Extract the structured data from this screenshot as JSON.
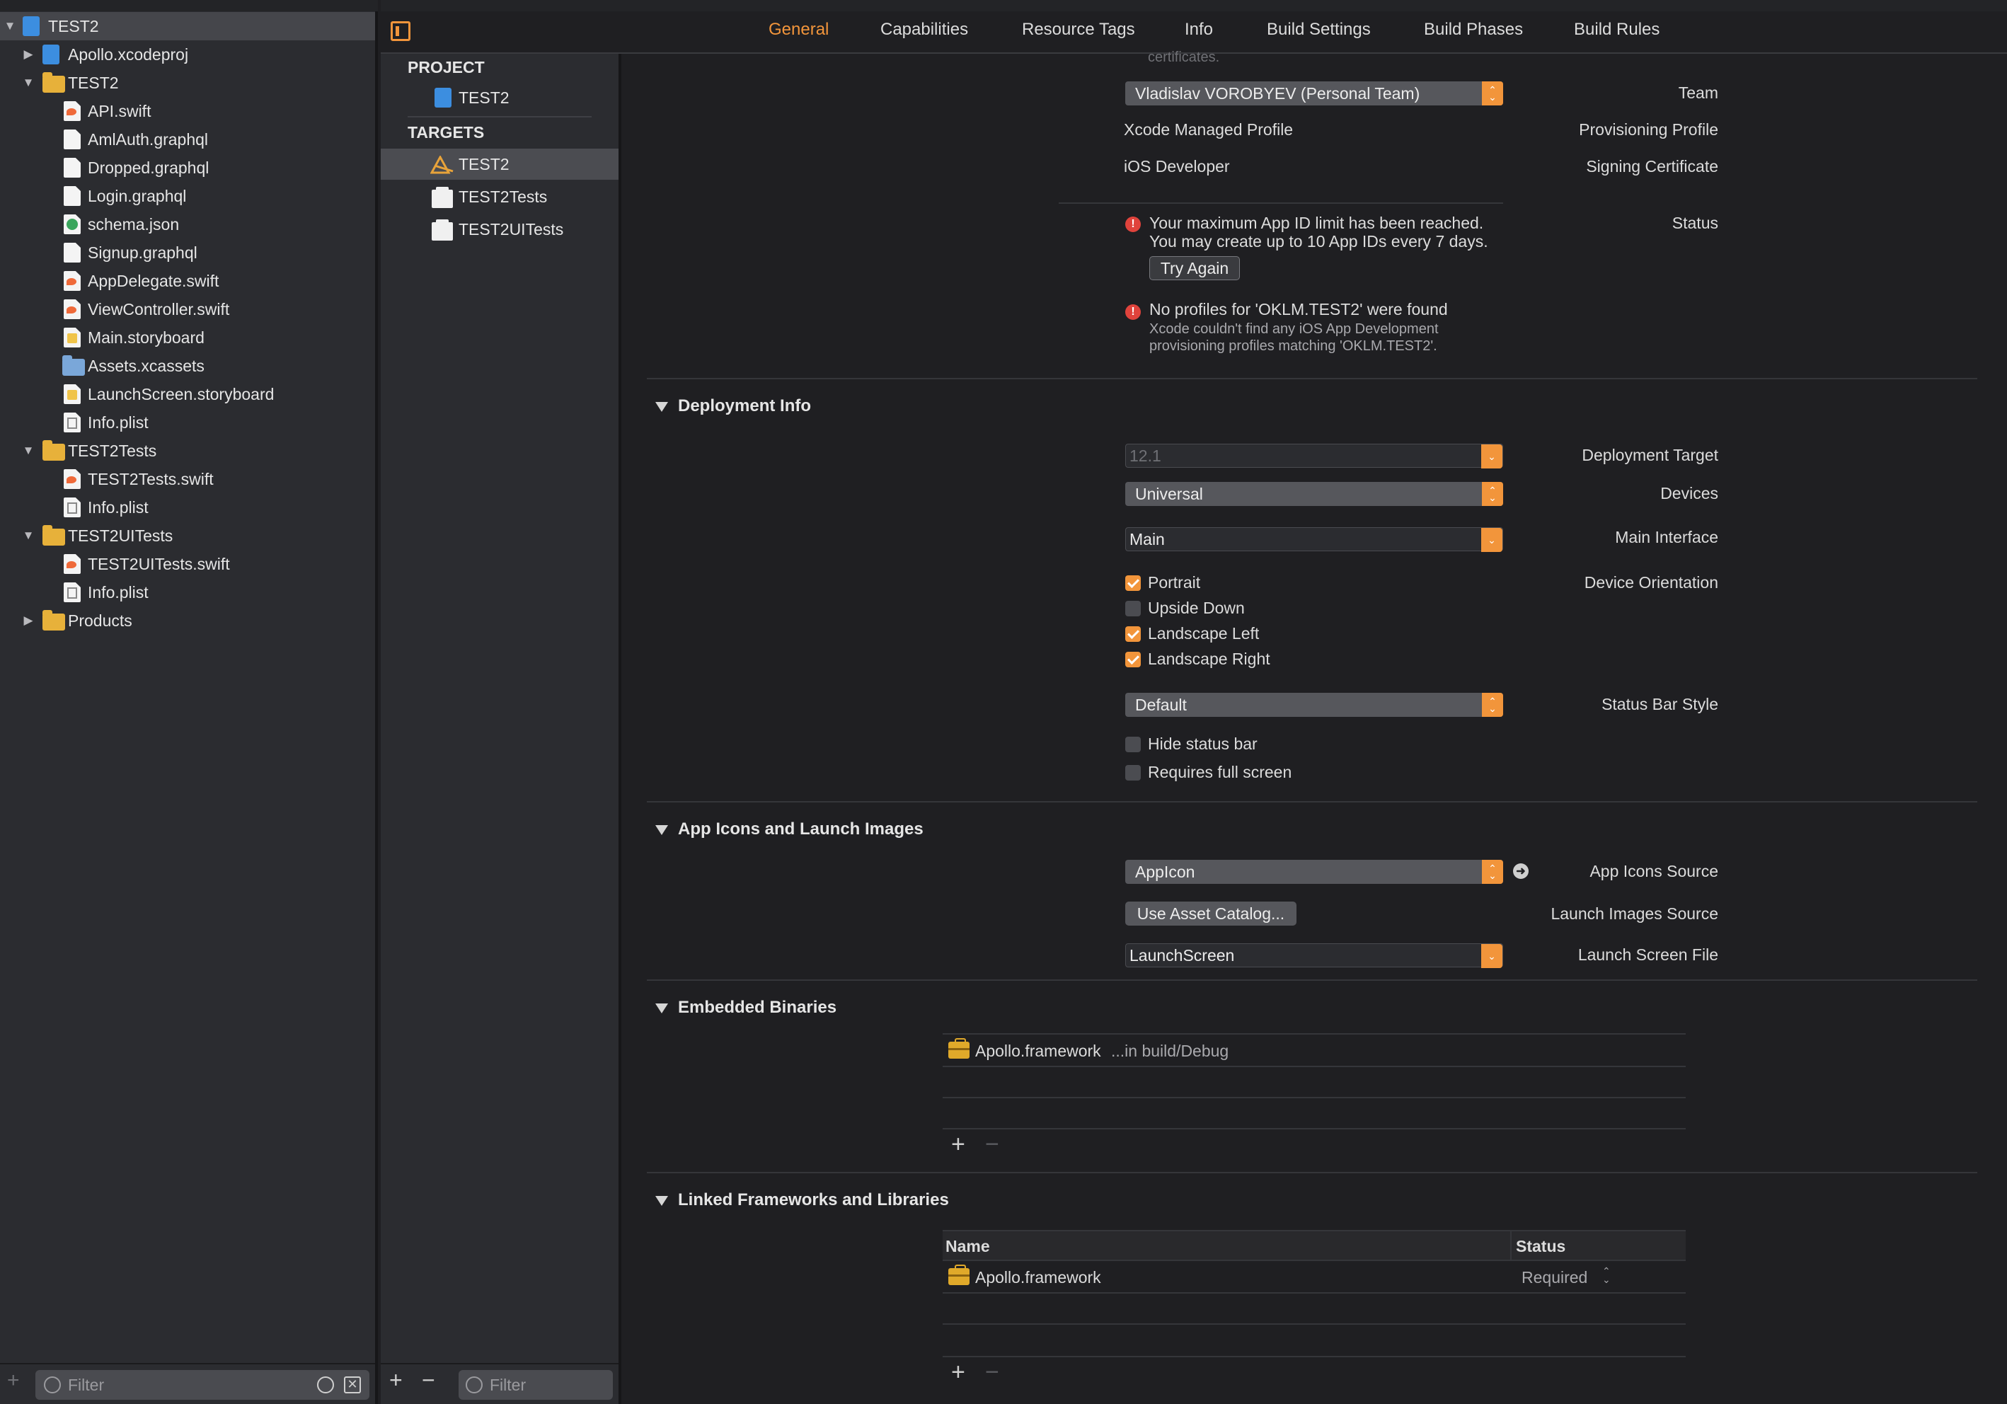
{
  "navigator": {
    "items": [
      {
        "label": "TEST2",
        "icon": "project-icon"
      },
      {
        "label": "Apollo.xcodeproj",
        "icon": "project-icon"
      },
      {
        "label": "TEST2",
        "icon": "folder-icon"
      },
      {
        "label": "API.swift",
        "icon": "swift-file-icon"
      },
      {
        "label": "AmlAuth.graphql",
        "icon": "file-icon"
      },
      {
        "label": "Dropped.graphql",
        "icon": "file-icon"
      },
      {
        "label": "Login.graphql",
        "icon": "file-icon"
      },
      {
        "label": "schema.json",
        "icon": "json-file-icon"
      },
      {
        "label": "Signup.graphql",
        "icon": "file-icon"
      },
      {
        "label": "AppDelegate.swift",
        "icon": "swift-file-icon"
      },
      {
        "label": "ViewController.swift",
        "icon": "swift-file-icon"
      },
      {
        "label": "Main.storyboard",
        "icon": "storyboard-file-icon"
      },
      {
        "label": "Assets.xcassets",
        "icon": "asset-catalog-icon"
      },
      {
        "label": "LaunchScreen.storyboard",
        "icon": "storyboard-file-icon"
      },
      {
        "label": "Info.plist",
        "icon": "plist-file-icon"
      },
      {
        "label": "TEST2Tests",
        "icon": "folder-icon"
      },
      {
        "label": "TEST2Tests.swift",
        "icon": "swift-file-icon"
      },
      {
        "label": "Info.plist",
        "icon": "plist-file-icon"
      },
      {
        "label": "TEST2UITests",
        "icon": "folder-icon"
      },
      {
        "label": "TEST2UITests.swift",
        "icon": "swift-file-icon"
      },
      {
        "label": "Info.plist",
        "icon": "plist-file-icon"
      },
      {
        "label": "Products",
        "icon": "folder-icon"
      }
    ],
    "filter_placeholder": "Filter"
  },
  "middle": {
    "project_header": "PROJECT",
    "project_item": "TEST2",
    "targets_header": "TARGETS",
    "targets": [
      "TEST2",
      "TEST2Tests",
      "TEST2UITests"
    ],
    "filter_placeholder": "Filter"
  },
  "tabs": [
    "General",
    "Capabilities",
    "Resource Tags",
    "Info",
    "Build Settings",
    "Build Phases",
    "Build Rules"
  ],
  "active_tab": "General",
  "signing": {
    "cut_text": "certificates.",
    "team_label": "Team",
    "team_value": "Vladislav VOROBYEV (Personal Team)",
    "profile_label": "Provisioning Profile",
    "profile_value": "Xcode Managed Profile",
    "cert_label": "Signing Certificate",
    "cert_value": "iOS Developer",
    "status_label": "Status",
    "error1_line1": "Your maximum App ID limit has been reached.",
    "error1_line2": "You may create up to 10 App IDs every 7 days.",
    "try_again": "Try Again",
    "error2_title": "No profiles for 'OKLM.TEST2' were found",
    "error2_line1": "Xcode couldn't find any iOS App Development",
    "error2_line2": "provisioning profiles matching 'OKLM.TEST2'."
  },
  "deployment": {
    "title": "Deployment Info",
    "target_label": "Deployment Target",
    "target_value": "12.1",
    "devices_label": "Devices",
    "devices_value": "Universal",
    "main_interface_label": "Main Interface",
    "main_interface_value": "Main",
    "orientation_label": "Device Orientation",
    "orientations": [
      {
        "label": "Portrait",
        "checked": true
      },
      {
        "label": "Upside Down",
        "checked": false
      },
      {
        "label": "Landscape Left",
        "checked": true
      },
      {
        "label": "Landscape Right",
        "checked": true
      }
    ],
    "status_bar_label": "Status Bar Style",
    "status_bar_value": "Default",
    "hide_status_bar": "Hide status bar",
    "full_screen": "Requires full screen"
  },
  "app_icons": {
    "title": "App Icons and Launch Images",
    "icons_source_label": "App Icons Source",
    "icons_source_value": "AppIcon",
    "launch_images_label": "Launch Images Source",
    "launch_images_button": "Use Asset Catalog...",
    "launch_screen_label": "Launch Screen File",
    "launch_screen_value": "LaunchScreen"
  },
  "embedded": {
    "title": "Embedded Binaries",
    "item_name": "Apollo.framework",
    "item_path": "...in build/Debug"
  },
  "linked": {
    "title": "Linked Frameworks and Libraries",
    "col_name": "Name",
    "col_status": "Status",
    "item_name": "Apollo.framework",
    "item_status": "Required"
  },
  "colors": {
    "accent": "#f2953b",
    "error": "#e0433c",
    "background": "#1f1f22",
    "panel": "#2b2c30"
  }
}
